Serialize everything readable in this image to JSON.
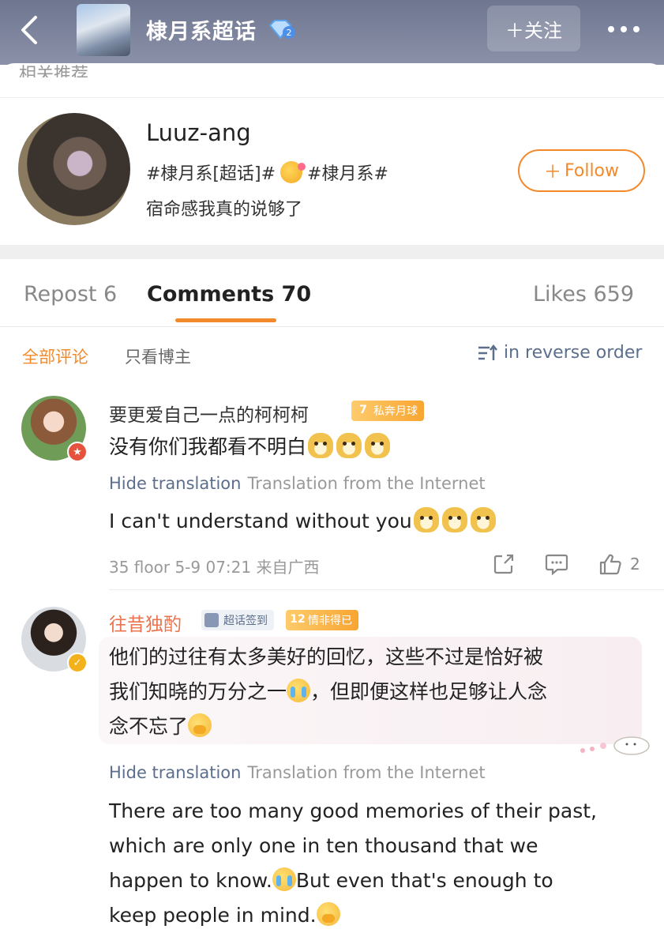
{
  "header": {
    "title": "棣月系超话",
    "badge_level": "2",
    "follow_label": "＋关注"
  },
  "section_peek": "相关推荐",
  "post_author": {
    "name": "Luuz-ang",
    "tags_part1": "#棣月系[超话]#",
    "tags_part2": "#棣月系#",
    "description": "宿命感我真的说够了",
    "follow_label": "Follow",
    "follow_plus": "＋"
  },
  "tabs": {
    "repost": "Repost 6",
    "comments": "Comments 70",
    "likes": "Likes 659"
  },
  "filters": {
    "all": "全部评论",
    "author_only": "只看博主",
    "sort": "in reverse order"
  },
  "comments": [
    {
      "name": "要更爱自己一点的柯柯柯",
      "level_num": "7",
      "level_label": "私奔月球",
      "text": "没有你们我都看不明白",
      "hide_translation": "Hide translation",
      "translation_source": "Translation from the Internet",
      "translation": "I can't understand without you",
      "meta": "35 floor  5-9 07:21  来自广西",
      "likes": "2"
    },
    {
      "name": "往昔独酌",
      "checkin_label": "超话签到",
      "level_num": "12",
      "level_label": "情非得已",
      "text_line1": "他们的过往有太多美好的回忆，这些不过是恰好被",
      "text_line2a": "我们知晓的万分之一",
      "text_line2b": "，但即便这样也足够让人念",
      "text_line3": "念不忘了",
      "hide_translation": "Hide translation",
      "translation_source": "Translation from the Internet",
      "tr_line1": "There are too many good memories of their past,",
      "tr_line2": "which are only one in ten thousand that we",
      "tr_line3a": "happen to know.",
      "tr_line3b": "But even that's enough to",
      "tr_line4": "keep people in mind."
    }
  ]
}
